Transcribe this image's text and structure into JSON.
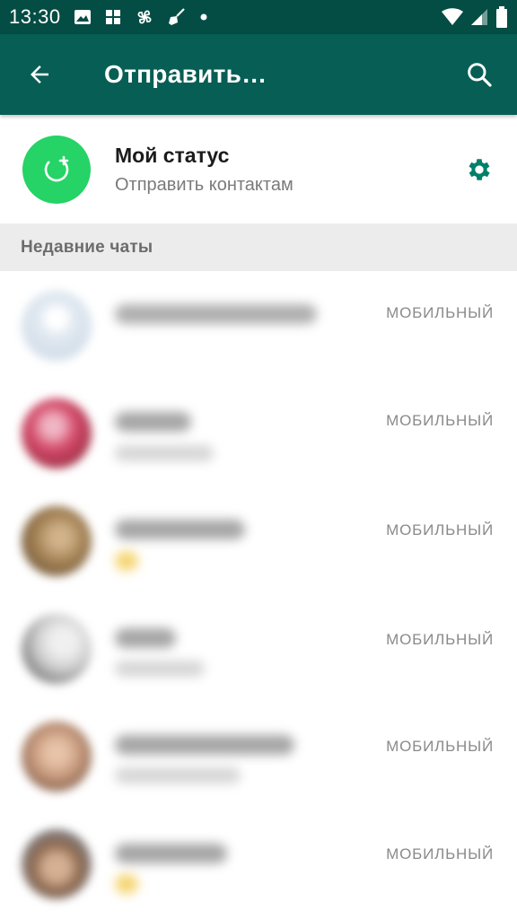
{
  "status_bar": {
    "time": "13:30",
    "left_icons": [
      "image-icon",
      "grid-icon",
      "pinwheel-icon",
      "broom-icon",
      "dot-icon"
    ],
    "right_icons": [
      "wifi-icon",
      "signal-icon",
      "battery-icon"
    ]
  },
  "app_bar": {
    "title": "Отправить…",
    "back_icon": "arrow-back-icon",
    "search_icon": "search-icon",
    "background": "#075e54"
  },
  "my_status": {
    "name": "Мой статус",
    "subtitle": "Отправить контактам",
    "avatar_color": "#25d366",
    "settings_icon": "gear-icon",
    "accent": "#008069"
  },
  "section": {
    "title": "Недавние чаты"
  },
  "chats": [
    {
      "label": "МОБИЛЬНЫЙ",
      "avatar_colors": [
        "#e2eaf2",
        "#c9d6e3"
      ]
    },
    {
      "label": "МОБИЛЬНЫЙ",
      "avatar_colors": [
        "#d44a6a",
        "#7a1f2c"
      ]
    },
    {
      "label": "МОБИЛЬНЫЙ",
      "avatar_colors": [
        "#a48255",
        "#4f3a26"
      ]
    },
    {
      "label": "МОБИЛЬНЫЙ",
      "avatar_colors": [
        "#cfcfcf",
        "#3b3b3b"
      ]
    },
    {
      "label": "МОБИЛЬНЫЙ",
      "avatar_colors": [
        "#c79a7d",
        "#5a3a2e"
      ]
    },
    {
      "label": "МОБИЛЬНЫЙ",
      "avatar_colors": [
        "#d5b093",
        "#6b8cad"
      ]
    }
  ]
}
